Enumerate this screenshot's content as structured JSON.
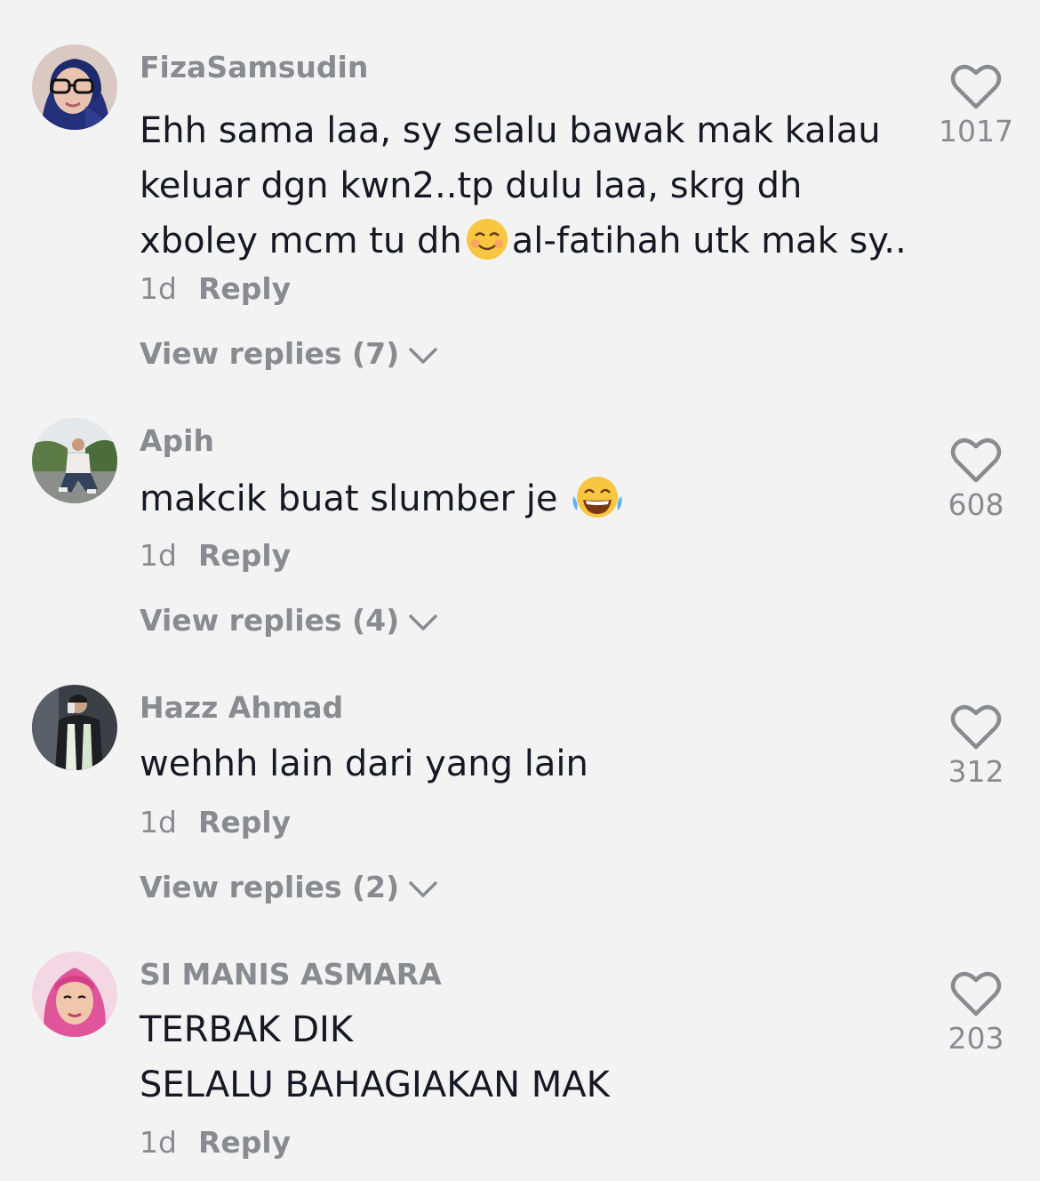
{
  "comments": [
    {
      "username": "FizaSamsudin",
      "text_lines": [
        "Ehh sama laa, sy selalu bawak mak kalau",
        "keluar dgn kwn2..tp dulu laa, skrg dh"
      ],
      "text_line3_before": "xboley mcm tu dh",
      "text_line3_after": "al-fatihah utk mak sy..",
      "emoji": "smiling-face-with-rosy-cheeks",
      "time": "1d",
      "reply_label": "Reply",
      "view_replies": "View replies (7)",
      "likes": "1017"
    },
    {
      "username": "Apih",
      "text": "makcik buat slumber je",
      "emoji": "face-with-tears-of-joy",
      "time": "1d",
      "reply_label": "Reply",
      "view_replies": "View replies (4)",
      "likes": "608"
    },
    {
      "username": "Hazz Ahmad",
      "text": "wehhh lain dari yang lain",
      "time": "1d",
      "reply_label": "Reply",
      "view_replies": "View replies (2)",
      "likes": "312"
    },
    {
      "username": "SI MANIS ASMARA",
      "text_lines": [
        "TERBAK DIK",
        "SELALU BAHAGIAKAN MAK"
      ],
      "time": "1d",
      "reply_label": "Reply",
      "likes": "203"
    }
  ],
  "icons": {
    "like": "heart-outline-icon",
    "expand": "chevron-down-icon"
  },
  "colors": {
    "background": "#f4f3f3",
    "primary_text": "#161823",
    "secondary_text": "#8a8b91"
  }
}
